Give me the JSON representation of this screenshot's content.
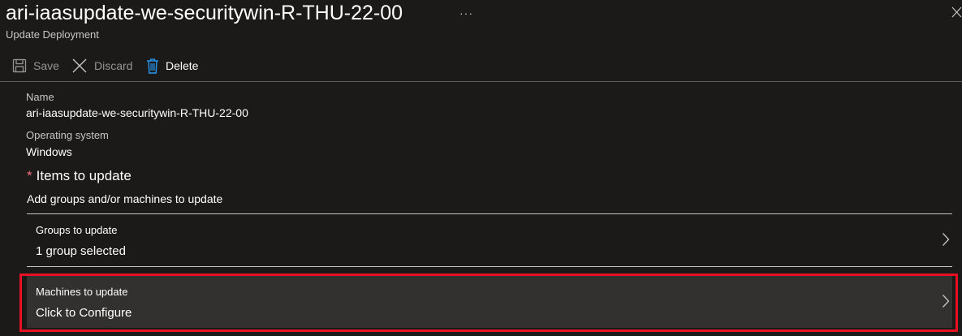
{
  "header": {
    "title": "ari-iaasupdate-we-securitywin-R-THU-22-00",
    "subtitle": "Update Deployment",
    "more_icon": "ellipsis-icon",
    "more_glyph": "···",
    "close_icon": "close-icon"
  },
  "toolbar": {
    "save_label": "Save",
    "discard_label": "Discard",
    "delete_label": "Delete",
    "save_icon": "save-icon",
    "discard_icon": "discard-icon",
    "delete_icon": "trash-icon"
  },
  "fields": {
    "name_label": "Name",
    "name_value": "ari-iaasupdate-we-securitywin-R-THU-22-00",
    "os_label": "Operating system",
    "os_value": "Windows"
  },
  "items_section": {
    "required_marker": "*",
    "title": "Items to update",
    "description": "Add groups and/or machines to update"
  },
  "rows": [
    {
      "label": "Groups to update",
      "value": "1 group selected"
    },
    {
      "label": "Machines to update",
      "value": "Click to Configure"
    }
  ],
  "colors": {
    "background": "#1b1a19",
    "highlight_border": "#e81123",
    "required_star": "#f1707b",
    "delete_icon": "#2899f5",
    "selected_row": "#323130"
  }
}
